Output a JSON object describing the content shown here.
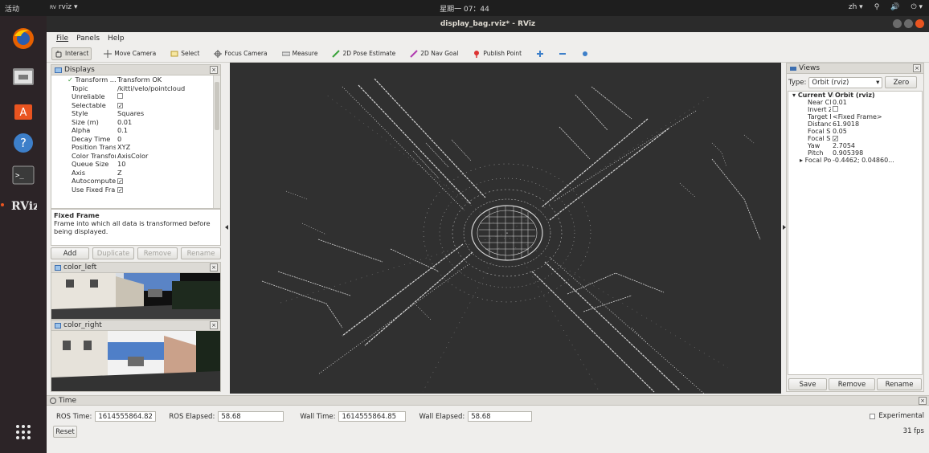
{
  "topbar": {
    "activities": "活动",
    "app_menu": "rviz ▾",
    "clock": "星期一 07：44",
    "lang": "zh ▾"
  },
  "window": {
    "title": "display_bag.rviz* - RViz"
  },
  "menu": [
    "File",
    "Panels",
    "Help"
  ],
  "toolbar": {
    "interact": "Interact",
    "move_camera": "Move Camera",
    "select": "Select",
    "focus_camera": "Focus Camera",
    "measure": "Measure",
    "pose_estimate": "2D Pose Estimate",
    "nav_goal": "2D Nav Goal",
    "publish_point": "Publish Point"
  },
  "displays": {
    "title": "Displays",
    "rows": [
      {
        "k": "Transform ...",
        "v": "Transform OK"
      },
      {
        "k": "Topic",
        "v": "/kitti/velo/pointcloud"
      },
      {
        "k": "Unreliable",
        "v": ""
      },
      {
        "k": "Selectable",
        "v": "✓"
      },
      {
        "k": "Style",
        "v": "Squares"
      },
      {
        "k": "Size (m)",
        "v": "0.01"
      },
      {
        "k": "Alpha",
        "v": "0.1"
      },
      {
        "k": "Decay Time",
        "v": "0"
      },
      {
        "k": "Position Transfor...",
        "v": "XYZ"
      },
      {
        "k": "Color Transformer",
        "v": "AxisColor"
      },
      {
        "k": "Queue Size",
        "v": "10"
      },
      {
        "k": "Axis",
        "v": "Z"
      },
      {
        "k": "Autocompute Val...",
        "v": "✓"
      },
      {
        "k": "Use Fixed Frame",
        "v": "✓"
      }
    ],
    "help_title": "Fixed Frame",
    "help_text": "Frame into which all data is transformed before being displayed.",
    "buttons": {
      "add": "Add",
      "duplicate": "Duplicate",
      "remove": "Remove",
      "rename": "Rename"
    }
  },
  "camera_panels": {
    "left": "color_left",
    "right": "color_right"
  },
  "views": {
    "title": "Views",
    "type_label": "Type:",
    "type_value": "Orbit (rviz)",
    "zero": "Zero",
    "current_view": {
      "k": "Current View",
      "v": "Orbit (rviz)"
    },
    "rows": [
      {
        "k": "Near Clip ...",
        "v": "0.01"
      },
      {
        "k": "Invert Z Axis",
        "v": ""
      },
      {
        "k": "Target Fra...",
        "v": "<Fixed Frame>"
      },
      {
        "k": "Distance",
        "v": "61.9018"
      },
      {
        "k": "Focal Shap...",
        "v": "0.05"
      },
      {
        "k": "Focal Shap...",
        "v": "✓"
      },
      {
        "k": "Yaw",
        "v": "2.7054"
      },
      {
        "k": "Pitch",
        "v": "0.905398"
      },
      {
        "k": "Focal Point",
        "v": "-0.4462; 0.04860..."
      }
    ],
    "buttons": {
      "save": "Save",
      "remove": "Remove",
      "rename": "Rename"
    }
  },
  "time": {
    "title": "Time",
    "ros_time_label": "ROS Time:",
    "ros_time": "1614555864.82",
    "ros_elapsed_label": "ROS Elapsed:",
    "ros_elapsed": "58.68",
    "wall_time_label": "Wall Time:",
    "wall_time": "1614555864.85",
    "wall_elapsed_label": "Wall Elapsed:",
    "wall_elapsed": "58.68",
    "experimental": "Experimental",
    "reset": "Reset",
    "fps": "31 fps"
  },
  "colors": {
    "accent": "#e95420",
    "render_bg": "#303030",
    "point": "#d9d9d9"
  }
}
